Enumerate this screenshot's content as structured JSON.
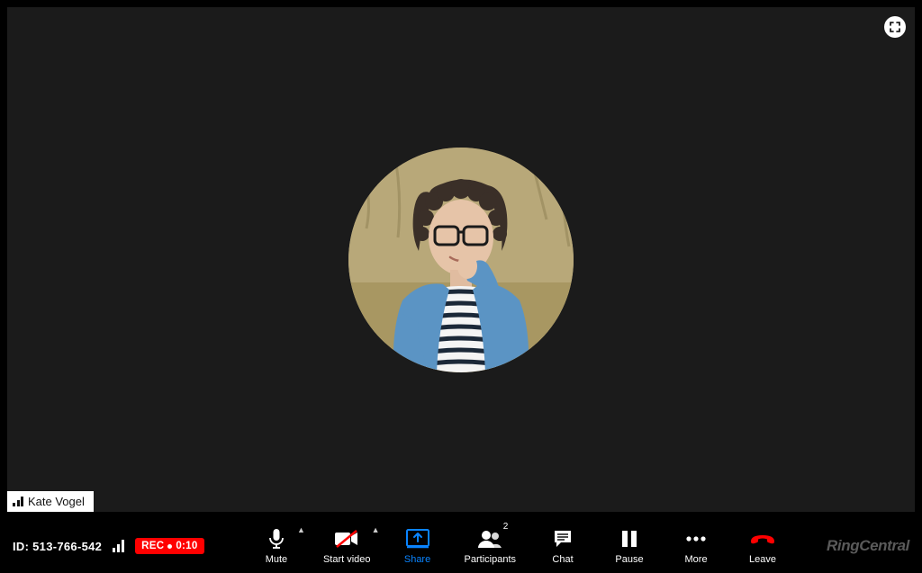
{
  "participant_name": "Kate Vogel",
  "meeting_id_label": "ID: 513-766-542",
  "recording": {
    "label": "REC",
    "time": "0:10"
  },
  "participants_count": "2",
  "controls": {
    "mute": "Mute",
    "start_video": "Start video",
    "share": "Share",
    "participants": "Participants",
    "chat": "Chat",
    "pause": "Pause",
    "more": "More",
    "leave": "Leave"
  },
  "brand": {
    "part1": "Ring",
    "part2": "Central"
  }
}
